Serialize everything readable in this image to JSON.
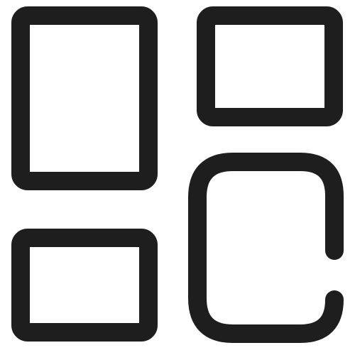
{
  "icon": {
    "name": "dashboard-layout-icon",
    "stroke_color": "#1e1e1e",
    "background_color": "#ffffff"
  }
}
